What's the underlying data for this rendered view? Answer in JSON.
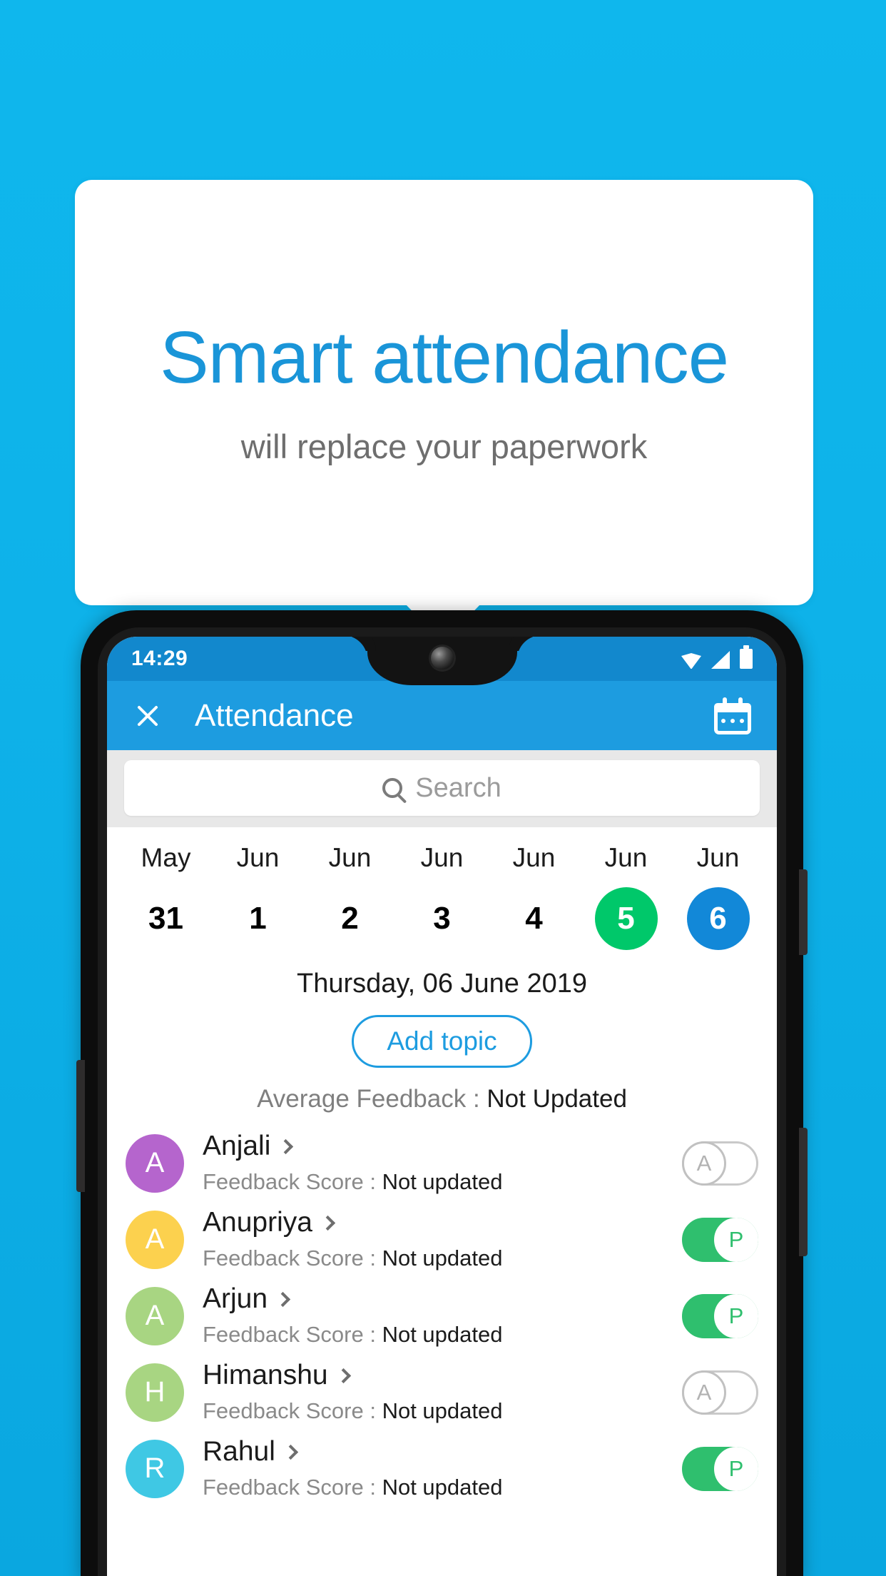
{
  "promo": {
    "title": "Smart attendance",
    "subtitle": "will replace your paperwork",
    "background_color": "#0fb6ec",
    "title_color": "#1a95d8"
  },
  "phone": {
    "statusbar": {
      "time": "14:29",
      "icons": [
        "wifi-icon",
        "signal-icon",
        "battery-icon"
      ]
    },
    "appbar": {
      "close_icon": "close-icon",
      "title": "Attendance",
      "calendar_icon": "calendar-icon",
      "color": "#1d9ce0"
    },
    "search": {
      "icon": "search-icon",
      "placeholder": "Search",
      "value": ""
    },
    "date_strip": [
      {
        "month": "May",
        "day": "31",
        "state": "normal"
      },
      {
        "month": "Jun",
        "day": "1",
        "state": "normal"
      },
      {
        "month": "Jun",
        "day": "2",
        "state": "normal"
      },
      {
        "month": "Jun",
        "day": "3",
        "state": "normal"
      },
      {
        "month": "Jun",
        "day": "4",
        "state": "normal"
      },
      {
        "month": "Jun",
        "day": "5",
        "state": "today"
      },
      {
        "month": "Jun",
        "day": "6",
        "state": "selected"
      }
    ],
    "today_color": "#00c86a",
    "selected_color": "#1288d8",
    "selected_date_label": "Thursday, 06 June 2019",
    "add_topic_label": "Add topic",
    "average_feedback": {
      "label": "Average Feedback : ",
      "value": "Not Updated"
    },
    "feedback_label": "Feedback Score : ",
    "students": [
      {
        "initial": "A",
        "name": "Anjali",
        "avatar_color": "#b565cd",
        "feedback_value": "Not updated",
        "attendance": "A",
        "attendance_state": "absent"
      },
      {
        "initial": "A",
        "name": "Anupriya",
        "avatar_color": "#fcd14e",
        "feedback_value": "Not updated",
        "attendance": "P",
        "attendance_state": "present"
      },
      {
        "initial": "A",
        "name": "Arjun",
        "avatar_color": "#a8d582",
        "feedback_value": "Not updated",
        "attendance": "P",
        "attendance_state": "present"
      },
      {
        "initial": "H",
        "name": "Himanshu",
        "avatar_color": "#a8d582",
        "feedback_value": "Not updated",
        "attendance": "A",
        "attendance_state": "absent"
      },
      {
        "initial": "R",
        "name": "Rahul",
        "avatar_color": "#3fc8e4",
        "feedback_value": "Not updated",
        "attendance": "P",
        "attendance_state": "present"
      }
    ]
  }
}
